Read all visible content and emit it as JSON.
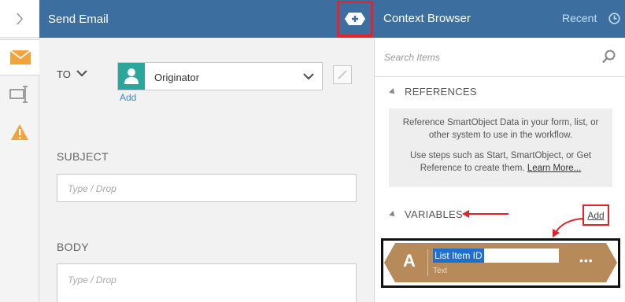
{
  "left_rail": {
    "expand_icon": "chevron-right-icon",
    "tabs": [
      {
        "icon": "envelope-icon",
        "active": true
      },
      {
        "icon": "text-input-icon",
        "active": false
      },
      {
        "icon": "warning-icon",
        "active": false
      }
    ]
  },
  "send_email": {
    "title": "Send Email",
    "add_context_icon": "add-context-icon",
    "to": {
      "label": "TO",
      "recipient": "Originator",
      "add_link": "Add"
    },
    "subject": {
      "label": "SUBJECT",
      "placeholder": "Type / Drop"
    },
    "body": {
      "label": "BODY",
      "placeholder": "Type / Drop"
    }
  },
  "context_browser": {
    "title": "Context Browser",
    "recent_label": "Recent",
    "search_placeholder": "Search Items",
    "references": {
      "heading": "REFERENCES",
      "text_1": "Reference SmartObject Data in your form, list, or other system to use in the workflow.",
      "text_2": "Use steps such as Start, SmartObject, or Get Reference to create them.",
      "learn_more": "Learn More..."
    },
    "variables": {
      "heading": "VARIABLES",
      "add_label": "Add",
      "items": [
        {
          "type_letter": "A",
          "name": "List Item ID",
          "type": "Text",
          "menu": "•••"
        }
      ]
    }
  },
  "colors": {
    "header_blue": "#3c6ea0",
    "highlight_red": "#e2232a",
    "variable_brown": "#b78a5a",
    "avatar_teal": "#2aa69a",
    "link_blue": "#3d87c9"
  }
}
